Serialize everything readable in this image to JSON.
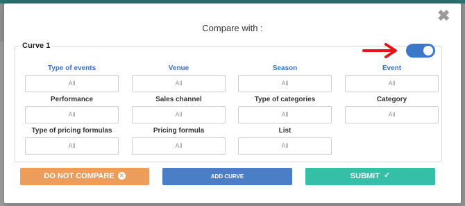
{
  "modal": {
    "title": "Compare with :",
    "close_glyph": "✖"
  },
  "curve": {
    "legend": "Curve 1",
    "toggle_on": true,
    "toggle_color": "#3b78c7",
    "arrow_color": "#e8121b"
  },
  "fields": [
    {
      "label": "Type of events",
      "value": "All",
      "highlight": true
    },
    {
      "label": "Venue",
      "value": "All",
      "highlight": true
    },
    {
      "label": "Season",
      "value": "All",
      "highlight": true
    },
    {
      "label": "Event",
      "value": "All",
      "highlight": true
    },
    {
      "label": "Performance",
      "value": "All",
      "highlight": false
    },
    {
      "label": "Sales channel",
      "value": "All",
      "highlight": false
    },
    {
      "label": "Type of categories",
      "value": "All",
      "highlight": false
    },
    {
      "label": "Category",
      "value": "All",
      "highlight": false
    },
    {
      "label": "Type of pricing formulas",
      "value": "All",
      "highlight": false
    },
    {
      "label": "Pricing formula",
      "value": "All",
      "highlight": false
    },
    {
      "label": "List",
      "value": "All",
      "highlight": false
    }
  ],
  "buttons": {
    "do_not_compare": "DO NOT COMPARE",
    "do_not_compare_icon": "×",
    "add_curve": "ADD CURVE",
    "submit": "SUBMIT",
    "submit_icon": "✓"
  },
  "colors": {
    "label_highlight": "#3a73c4",
    "orange": "#ec9d5b",
    "blue": "#4a7fc5",
    "teal": "#35bfa6"
  }
}
